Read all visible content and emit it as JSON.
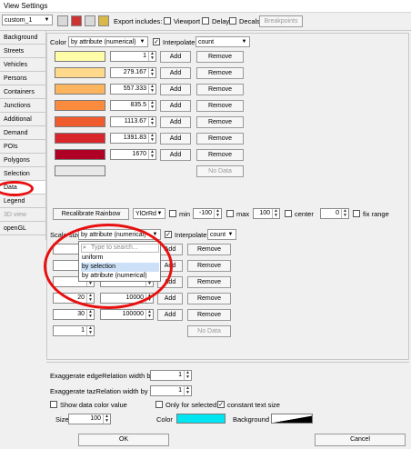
{
  "window": {
    "title": "View Settings"
  },
  "toolbar": {
    "scheme": "custom_1",
    "export_label": "Export includes:",
    "viewport": "Viewport",
    "delay": "Delay",
    "decals": "Decals",
    "breakpoints": "Breakpoints"
  },
  "sidebar": {
    "items": [
      {
        "label": "Background"
      },
      {
        "label": "Streets"
      },
      {
        "label": "Vehicles"
      },
      {
        "label": "Persons"
      },
      {
        "label": "Containers"
      },
      {
        "label": "Junctions"
      },
      {
        "label": "Additional"
      },
      {
        "label": "Demand"
      },
      {
        "label": "POIs"
      },
      {
        "label": "Polygons"
      },
      {
        "label": "Selection"
      },
      {
        "label": "Data"
      },
      {
        "label": "Legend"
      },
      {
        "label": "3D view"
      },
      {
        "label": "openGL"
      }
    ]
  },
  "color_section": {
    "color_label": "Color",
    "color_mode": "by attribute (numerical)",
    "interpolate_label": "Interpolate",
    "attribute": "count",
    "rows": [
      {
        "color": "#fffda8",
        "value": "1"
      },
      {
        "color": "#fed98b",
        "value": "279.167"
      },
      {
        "color": "#fdb45e",
        "value": "557.333"
      },
      {
        "color": "#fb8c3d",
        "value": "835.5"
      },
      {
        "color": "#f05b2d",
        "value": "1113.67"
      },
      {
        "color": "#d9262a",
        "value": "1391.83"
      },
      {
        "color": "#b10026",
        "value": "1670"
      },
      {
        "color": "#e8e8e8",
        "value": ""
      }
    ],
    "add_label": "Add",
    "remove_label": "Remove",
    "nodata_label": "No Data"
  },
  "rainbow": {
    "recalibrate_label": "Recalibrate Rainbow",
    "palette": "YlOrRd",
    "min_label": "min",
    "min_value": "-100",
    "max_label": "max",
    "max_value": "100",
    "center_label": "center",
    "center_value": "0",
    "fixrange_label": "fix range"
  },
  "scale_section": {
    "scale_label": "Scale size",
    "scale_mode": "by attribute (numerical)",
    "interpolate_label": "Interpolate",
    "attribute": "count",
    "rows": [
      {
        "left": "",
        "right": ""
      },
      {
        "left": "",
        "right": ""
      },
      {
        "left": "",
        "right": ""
      },
      {
        "left": "20",
        "right": "10000"
      },
      {
        "left": "30",
        "right": "100000"
      },
      {
        "left": "1",
        "right": ""
      }
    ],
    "add_label": "Add",
    "remove_label": "Remove",
    "nodata_label": "No Data"
  },
  "dropdown": {
    "search_placeholder": "Type to search...",
    "options": [
      "uniform",
      "by selection",
      "by attribute (numerical)"
    ]
  },
  "bottom": {
    "edge_label": "Exaggerate edgeRelation width by",
    "edge_value": "1",
    "taz_label": "Exaggerate tazRelation width by",
    "taz_value": "1",
    "show_color_label": "Show data color value",
    "only_selected_label": "Only for selected",
    "constant_text_label": "constant text size",
    "size_label": "Size",
    "size_value": "100",
    "color_label": "Color",
    "color_value": "#00e5f2",
    "background_label": "Background"
  },
  "buttons": {
    "ok": "OK",
    "cancel": "Cancel"
  }
}
